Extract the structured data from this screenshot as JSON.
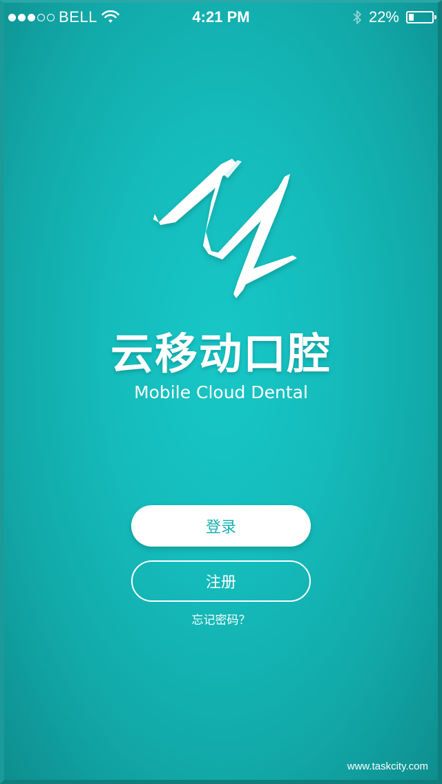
{
  "status_bar": {
    "signal_filled": 3,
    "signal_total": 5,
    "carrier": "BELL",
    "time": "4:21 PM",
    "battery_text": "22%",
    "battery_level": 0.22,
    "icons": [
      "wifi-icon",
      "bluetooth-icon",
      "battery-icon"
    ]
  },
  "app": {
    "logo": "brush-stroke-m-logo",
    "name": "云移动口腔",
    "subtitle": "Mobile Cloud Dental"
  },
  "actions": {
    "login_label": "登录",
    "register_label": "注册",
    "forgot_label": "忘记密码？"
  },
  "watermark": "www.taskcity.com",
  "colors": {
    "background": "#15bcbc",
    "accent_text": "#19b0b0",
    "button_fill": "#ffffff"
  }
}
